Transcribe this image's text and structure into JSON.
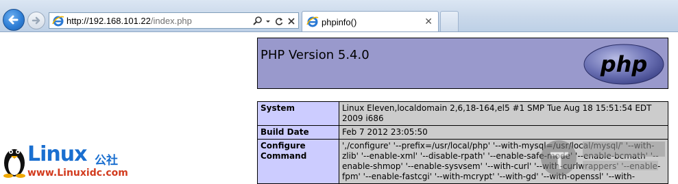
{
  "browser": {
    "url_host": "http://192.168.101.22",
    "url_path": "/index.php",
    "tab_title": "phpinfo()",
    "search_icon": "search-icon",
    "refresh_icon": "refresh-icon",
    "stop_icon": "close-icon"
  },
  "php": {
    "version_title": "PHP Version 5.4.0",
    "logo_text": "php"
  },
  "info_rows": [
    {
      "key": "System",
      "value": "Linux Eleven,localdomain 2,6,18-164,el5 #1 SMP Tue Aug 18 15:51:54 EDT 2009 i686"
    },
    {
      "key": "Build Date",
      "value": "Feb 7 2012 23:05:50"
    },
    {
      "key": "Configure Command",
      "value": "',/configure' '--prefix=/usr/local/php' '--with-mysql=/usr/local/mysql/' '--with-zlib' '--enable-xml' '--disable-rpath' '--enable-safe-mode' '--enable-bcmath' '--enable-shmop' '--enable-sysvsem' '--with-curl' '--with-curlwrappers' '--enable-fpm' '--enable-fastcgi' '--with-mcrypt' '--with-gd' '--with-openssl' '--with-"
    }
  ],
  "watermark": {
    "brand": "Linux",
    "brand_cn": "公社",
    "site": "www.Linuxidc.com"
  },
  "colors": {
    "php_header_bg": "#9999cc",
    "key_cell_bg": "#ccccff",
    "value_cell_bg": "#cccccc"
  }
}
